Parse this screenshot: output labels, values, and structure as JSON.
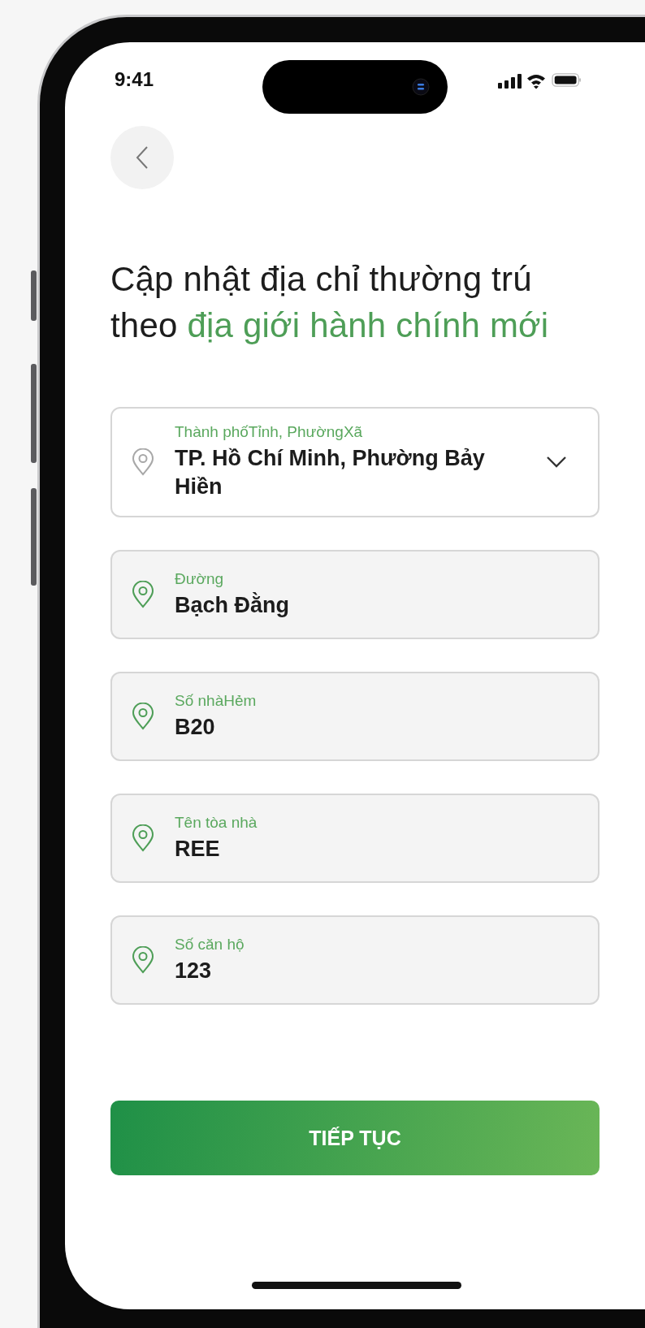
{
  "status_bar": {
    "time": "9:41"
  },
  "title": "Cập nhật địa chỉ thường trú theo",
  "title_highlight": "địa giới hành chính mới",
  "fields": [
    {
      "kind": "dropdown",
      "label": "Thành phốTỉnh, PhườngXã",
      "value": "TP. Hồ Chí Minh, Phường Bảy Hiền"
    },
    {
      "kind": "text",
      "label": "Đường",
      "value": "Bạch Đằng"
    },
    {
      "kind": "text",
      "label": "Số nhàHẻm",
      "value": "B20"
    },
    {
      "kind": "text",
      "label": "Tên tòa nhà",
      "value": "REE"
    },
    {
      "kind": "text",
      "label": "Số căn hộ",
      "value": "123"
    }
  ],
  "button": {
    "label": "TIẾP TỤC"
  }
}
